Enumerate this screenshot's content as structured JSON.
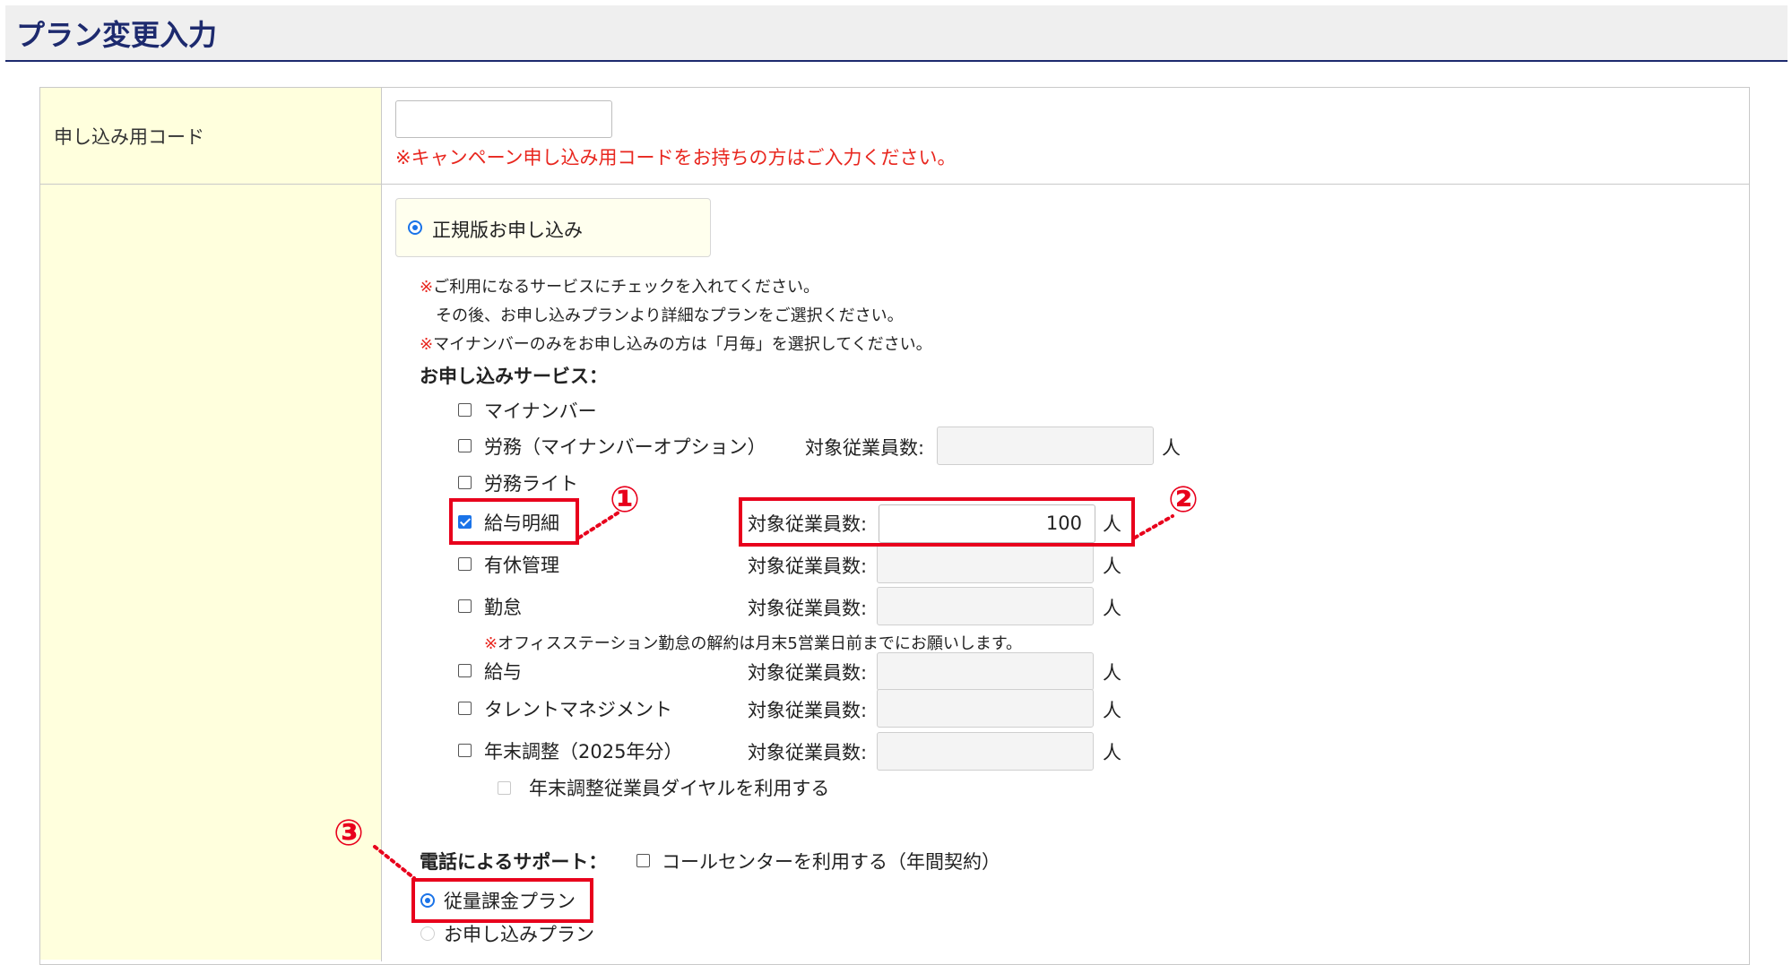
{
  "page": {
    "title": "プラン変更入力"
  },
  "code_row": {
    "label": "申し込み用コード",
    "input_value": "",
    "note": "※キャンペーン申し込み用コードをお持ちの方はご入力ください。"
  },
  "plan_section": {
    "official_radio_label": "正規版お申し込み",
    "notes": {
      "mark": "※",
      "line1": "ご利用になるサービスにチェックを入れてください。",
      "line2": "その後、お申し込みプランより詳細なプランをご選択ください。",
      "line3": "マイナンバーのみをお申し込みの方は「月毎」を選択してください。"
    },
    "services_heading": "お申し込みサービス：",
    "employee_count_label": "対象従業員数:",
    "unit": "人",
    "services": [
      {
        "label": "マイナンバー",
        "checked": false
      },
      {
        "label": "労務（マイナンバーオプション）",
        "checked": false,
        "count": ""
      },
      {
        "label": "労務ライト",
        "checked": false
      },
      {
        "label": "給与明細",
        "checked": true,
        "count": "100"
      },
      {
        "label": "有休管理",
        "checked": false,
        "count": ""
      },
      {
        "label": "勤怠",
        "checked": false,
        "count": ""
      },
      {
        "label": "給与",
        "checked": false,
        "count": ""
      },
      {
        "label": "タレントマネジメント",
        "checked": false,
        "count": ""
      },
      {
        "label": "年末調整（2025年分）",
        "checked": false,
        "count": ""
      }
    ],
    "kintai_note": "オフィスステーション勤怠の解約は月末5営業日前までにお願いします。",
    "yearend_dial_label": "年末調整従業員ダイヤルを利用する",
    "phone_support_label": "電話によるサポート：",
    "call_center_label": "コールセンターを利用する（年間契約）",
    "plan_options": [
      {
        "label": "従量課金プラン",
        "selected": true
      },
      {
        "label": "お申し込みプラン",
        "selected": false
      }
    ]
  },
  "annotations": {
    "one": "①",
    "two": "②",
    "three": "③"
  },
  "colors": {
    "header_text": "#1d2a6e",
    "label_bg": "#ffffdd",
    "highlight": "#e8001c",
    "note_red": "#e8261e",
    "accent": "#1a73e8"
  }
}
